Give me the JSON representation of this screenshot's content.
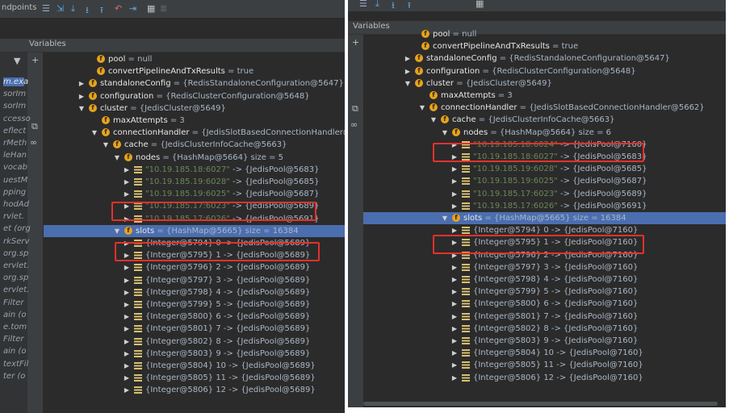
{
  "left": {
    "toolbar": {
      "breakpoints_label": "ndpoints"
    },
    "header": {
      "variables_label": "Variables"
    },
    "side_labels": [
      "m.exa",
      "sorIm",
      "sorIm",
      "ccesso",
      "eflect",
      "rMeth",
      "leHan",
      "vocab",
      "uestM",
      "pping",
      "hodAd",
      "rvlet.",
      "et (org",
      "rkServ",
      "org.sp",
      "ervlet.",
      "org.sp",
      "ervlet.",
      "Filter",
      "ain (o",
      "e.tom",
      "Filter",
      "ain (o",
      "textFil",
      "ter (o"
    ],
    "rows": [
      {
        "name": "pool",
        "value": " = null"
      },
      {
        "name": "convertPipelineAndTxResults",
        "value": " = true"
      },
      {
        "name": "standaloneConfig",
        "value": " = {RedisStandaloneConfiguration@5647}"
      },
      {
        "name": "configuration",
        "value": " = {RedisClusterConfiguration@5648}"
      },
      {
        "name": "cluster",
        "value": " = {JedisCluster@5649}"
      },
      {
        "name": "maxAttempts",
        "value": " = 3"
      },
      {
        "name": "connectionHandler",
        "value": " = {JedisSlotBasedConnectionHandler@5662}"
      },
      {
        "name": "cache",
        "value": " = {JedisClusterInfoCache@5663}"
      },
      {
        "name": "nodes",
        "value": " = {HashMap@5664}  size = 5"
      },
      {
        "key": "\"10.19.185.18:6027\"",
        "value": " -> {JedisPool@5683}"
      },
      {
        "key": "\"10.19.185.19:6028\"",
        "value": " -> {JedisPool@5685}"
      },
      {
        "key": "\"10.19.185.19:6025\"",
        "value": " -> {JedisPool@5687}"
      },
      {
        "key": "\"10.19.185.17:6023\"",
        "value": " -> {JedisPool@5689}"
      },
      {
        "key": "\"10.19.185.17:6026\"",
        "value": " -> {JedisPool@5691}"
      },
      {
        "name": "slots",
        "value": " = {HashMap@5665}  size = 16384"
      },
      {
        "key": "{Integer@5794} 0",
        "value": " -> {JedisPool@5689}"
      },
      {
        "key": "{Integer@5795} 1",
        "value": " -> {JedisPool@5689}"
      },
      {
        "key": "{Integer@5796} 2",
        "value": " -> {JedisPool@5689}"
      },
      {
        "key": "{Integer@5797} 3",
        "value": " -> {JedisPool@5689}"
      },
      {
        "key": "{Integer@5798} 4",
        "value": " -> {JedisPool@5689}"
      },
      {
        "key": "{Integer@5799} 5",
        "value": " -> {JedisPool@5689}"
      },
      {
        "key": "{Integer@5800} 6",
        "value": " -> {JedisPool@5689}"
      },
      {
        "key": "{Integer@5801} 7",
        "value": " -> {JedisPool@5689}"
      },
      {
        "key": "{Integer@5802} 8",
        "value": " -> {JedisPool@5689}"
      },
      {
        "key": "{Integer@5803} 9",
        "value": " -> {JedisPool@5689}"
      },
      {
        "key": "{Integer@5804} 10",
        "value": " -> {JedisPool@5689}"
      },
      {
        "key": "{Integer@5805} 11",
        "value": " -> {JedisPool@5689}"
      },
      {
        "key": "{Integer@5806} 12",
        "value": " -> {JedisPool@5689}"
      }
    ]
  },
  "right": {
    "header": {
      "variables_label": "Variables"
    },
    "rows": [
      {
        "name": "pool",
        "value": " = null"
      },
      {
        "name": "convertPipelineAndTxResults",
        "value": " = true"
      },
      {
        "name": "standaloneConfig",
        "value": " = {RedisStandaloneConfiguration@5647}"
      },
      {
        "name": "configuration",
        "value": " = {RedisClusterConfiguration@5648}"
      },
      {
        "name": "cluster",
        "value": " = {JedisCluster@5649}"
      },
      {
        "name": "maxAttempts",
        "value": " = 3"
      },
      {
        "name": "connectionHandler",
        "value": " = {JedisSlotBasedConnectionHandler@5662}"
      },
      {
        "name": "cache",
        "value": " = {JedisClusterInfoCache@5663}"
      },
      {
        "name": "nodes",
        "value": " = {HashMap@5664}  size = 6"
      },
      {
        "key": "\"10.19.185.18:6024\"",
        "value": " -> {JedisPool@7160}"
      },
      {
        "key": "\"10.19.185.18:6027\"",
        "value": " -> {JedisPool@5683}"
      },
      {
        "key": "\"10.19.185.19:6028\"",
        "value": " -> {JedisPool@5685}"
      },
      {
        "key": "\"10.19.185.19:6025\"",
        "value": " -> {JedisPool@5687}"
      },
      {
        "key": "\"10.19.185.17:6023\"",
        "value": " -> {JedisPool@5689}"
      },
      {
        "key": "\"10.19.185.17:6026\"",
        "value": " -> {JedisPool@5691}"
      },
      {
        "name": "slots",
        "value": " = {HashMap@5665}  size = 16384"
      },
      {
        "key": "{Integer@5794} 0",
        "value": " -> {JedisPool@7160}"
      },
      {
        "key": "{Integer@5795} 1",
        "value": " -> {JedisPool@7160}"
      },
      {
        "key": "{Integer@5796} 2",
        "value": " -> {JedisPool@7160}"
      },
      {
        "key": "{Integer@5797} 3",
        "value": " -> {JedisPool@7160}"
      },
      {
        "key": "{Integer@5798} 4",
        "value": " -> {JedisPool@7160}"
      },
      {
        "key": "{Integer@5799} 5",
        "value": " -> {JedisPool@7160}"
      },
      {
        "key": "{Integer@5800} 6",
        "value": " -> {JedisPool@7160}"
      },
      {
        "key": "{Integer@5801} 7",
        "value": " -> {JedisPool@7160}"
      },
      {
        "key": "{Integer@5802} 8",
        "value": " -> {JedisPool@7160}"
      },
      {
        "key": "{Integer@5803} 9",
        "value": " -> {JedisPool@7160}"
      },
      {
        "key": "{Integer@5804} 10",
        "value": " -> {JedisPool@7160}"
      },
      {
        "key": "{Integer@5805} 11",
        "value": " -> {JedisPool@7160}"
      },
      {
        "key": "{Integer@5806} 12",
        "value": " -> {JedisPool@7160}"
      }
    ]
  },
  "colors": {
    "background": "#2b2b2b",
    "panel": "#3c3f41",
    "selection": "#4b6eaf",
    "field_icon": "#e6a320",
    "string": "#6a8759",
    "highlight_box": "#e5312c"
  }
}
